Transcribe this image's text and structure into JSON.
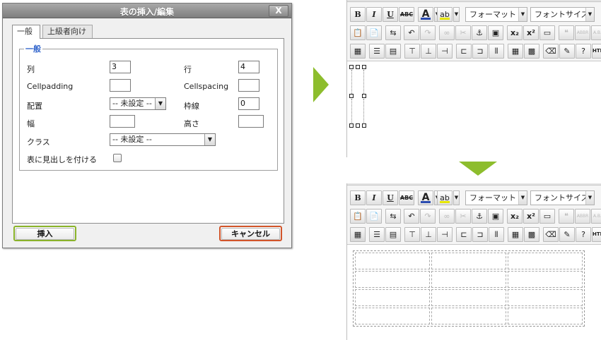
{
  "dialog": {
    "title": "表の挿入/編集",
    "close_label": "X",
    "tabs": [
      {
        "label": "一般",
        "active": true
      },
      {
        "label": "上級者向け",
        "active": false
      }
    ],
    "legend": "一般",
    "fields": {
      "rows_label": "列",
      "rows_value": "3",
      "cols_label": "行",
      "cols_value": "4",
      "cellpadding_label": "Cellpadding",
      "cellpadding_value": "",
      "cellspacing_label": "Cellspacing",
      "cellspacing_value": "",
      "align_label": "配置",
      "align_value": "-- 未設定 --",
      "border_label": "枠線",
      "border_value": "0",
      "width_label": "幅",
      "width_value": "",
      "height_label": "高さ",
      "height_value": "",
      "class_label": "クラス",
      "class_value": "-- 未設定 --",
      "caption_label": "表に見出しを付ける",
      "caption_checked": false
    },
    "insert_label": "挿入",
    "cancel_label": "キャンセル",
    "colors": {
      "insert_border": "#8ab32a",
      "cancel_border": "#d2552a",
      "legend": "#3366cc"
    }
  },
  "arrows": {
    "color": "#8dbd2d"
  },
  "editor": {
    "toolbar1": {
      "bold": "B",
      "italic": "I",
      "underline": "U",
      "strike": "ABC",
      "forecolor": "A",
      "hilite": "ab",
      "format_label": "フォーマット",
      "font_label": "フォントサイズ"
    },
    "toolbar2": {
      "icons": [
        "paste-text-icon",
        "paste-word-icon",
        "find-replace-icon",
        "undo-icon",
        "redo-icon",
        "link-icon",
        "unlink-icon",
        "anchor-icon",
        "image-icon",
        "subscript-icon",
        "superscript-icon",
        "media-icon",
        "blockquote-icon",
        "abbr-icon",
        "acronym-icon"
      ],
      "sub_label": "x₂",
      "sup_label": "x²",
      "abbr_label": "ABBR",
      "acronym_label": "A.B.C"
    },
    "toolbar3": {
      "icons": [
        "table-edit-icon",
        "row-props-icon",
        "cell-props-icon",
        "insert-row-before-icon",
        "insert-row-after-icon",
        "delete-row-icon",
        "insert-col-before-icon",
        "insert-col-after-icon",
        "delete-col-icon",
        "visual-aid-icon",
        "table-grid-icon",
        "eraser-icon",
        "cleanup-icon",
        "help-icon",
        "html-icon"
      ],
      "html_label": "HTML"
    },
    "result_table": {
      "rows": 4,
      "cols": 3
    }
  }
}
